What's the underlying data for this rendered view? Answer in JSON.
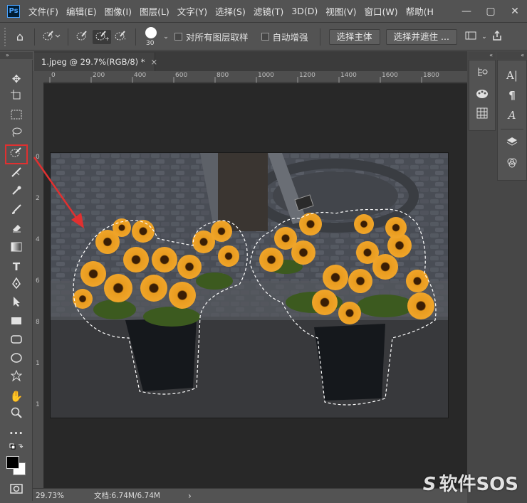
{
  "app": {
    "logo": "Ps"
  },
  "menu": [
    "文件(F)",
    "编辑(E)",
    "图像(I)",
    "图层(L)",
    "文字(Y)",
    "选择(S)",
    "滤镜(T)",
    "3D(D)",
    "视图(V)",
    "窗口(W)",
    "帮助(H"
  ],
  "options_bar": {
    "brush_size": "30",
    "sample_all_layers_label": "对所有图层取样",
    "auto_enhance_label": "自动增强",
    "select_subject_label": "选择主体",
    "select_mask_label": "选择并遮住 ..."
  },
  "document": {
    "tab_title": "1.jpeg @ 29.7%(RGB/8) *",
    "tab_close": "×"
  },
  "ruler": {
    "top_ticks": [
      "0",
      "200",
      "400",
      "600",
      "800",
      "1000",
      "1200",
      "1400",
      "1600",
      "1800"
    ],
    "left_ticks": [
      "0",
      "2",
      "4",
      "6",
      "8",
      "1",
      "1"
    ]
  },
  "status": {
    "zoom": "29.73%",
    "doc_size": "文档:6.74M/6.74M",
    "arrow": "›"
  },
  "watermark": "软件SOS",
  "colors": {
    "highlight": "#e03030",
    "ps_blue": "#4aa3ff"
  }
}
